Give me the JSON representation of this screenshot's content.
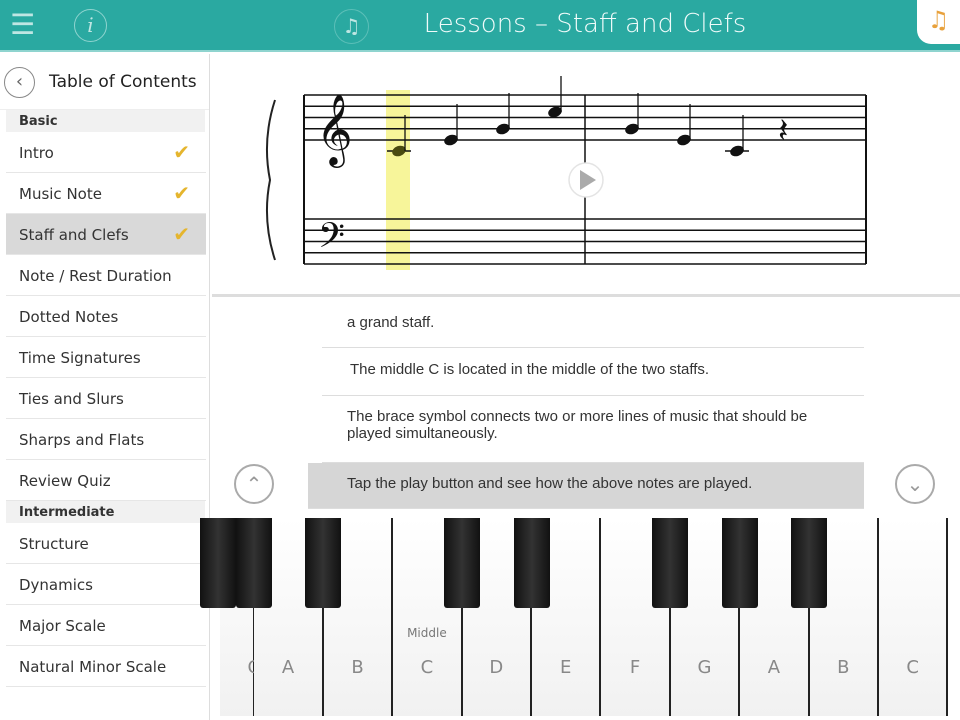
{
  "header": {
    "title": "Lessons – Staff and Clefs",
    "menu_icon": "list-icon",
    "info_icon": "info-icon",
    "music_icon": "music-note-icon",
    "logo": "app-logo"
  },
  "sidebar": {
    "title": "Table of Contents",
    "sections": [
      {
        "label": "Basic",
        "items": [
          {
            "label": "Intro",
            "done": true
          },
          {
            "label": "Music Note",
            "done": true
          },
          {
            "label": "Staff and Clefs",
            "done": true,
            "selected": true
          },
          {
            "label": "Note / Rest Duration"
          },
          {
            "label": "Dotted Notes"
          },
          {
            "label": "Time Signatures"
          },
          {
            "label": "Ties and Slurs"
          },
          {
            "label": "Sharps and Flats"
          },
          {
            "label": "Review Quiz"
          }
        ]
      },
      {
        "label": "Intermediate",
        "items": [
          {
            "label": "Structure"
          },
          {
            "label": "Dynamics"
          },
          {
            "label": "Major Scale"
          },
          {
            "label": "Natural Minor Scale"
          }
        ]
      }
    ]
  },
  "score": {
    "notes": [
      "C4",
      "E4",
      "G4",
      "C5",
      "G4",
      "E4",
      "C4",
      "rest"
    ],
    "highlighted_note": 0,
    "highlight_color": "#f7f59a"
  },
  "content": {
    "lines": [
      "a grand staff.",
      "The middle C is located in the middle of the two staffs.",
      "The brace symbol connects two or more lines of music that should be played simultaneously.",
      "Tap the play button and see how the above notes are played."
    ],
    "highlighted_line": 3
  },
  "piano": {
    "keys": [
      "G",
      "A",
      "B",
      "C",
      "D",
      "E",
      "F",
      "G",
      "A",
      "B",
      "C"
    ],
    "middle_label": "Middle"
  },
  "colors": {
    "accent": "#2aa9a1",
    "check": "#e5b52d"
  }
}
